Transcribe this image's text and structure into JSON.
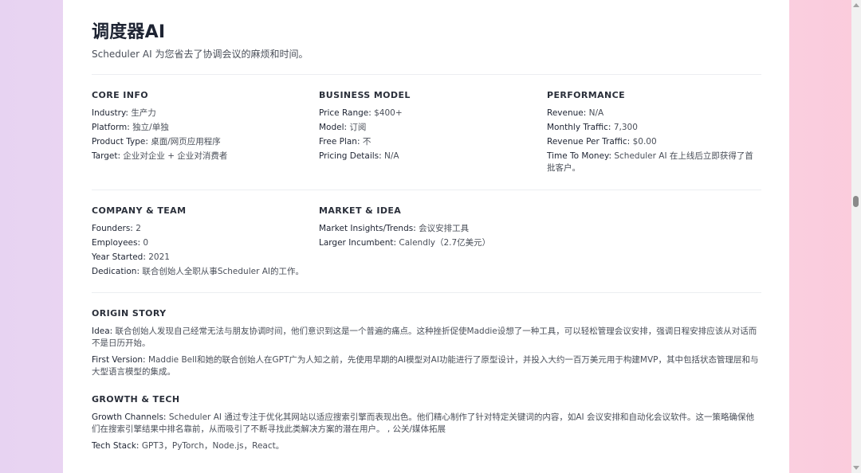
{
  "header": {
    "title": "调度器AI",
    "subtitle": "Scheduler AI 为您省去了协调会议的麻烦和时间。"
  },
  "core_info": {
    "title": "CORE INFO",
    "items": [
      {
        "label": "Industry:",
        "value": "生产力"
      },
      {
        "label": "Platform:",
        "value": "独立/单独"
      },
      {
        "label": "Product Type:",
        "value": "桌面/网页应用程序"
      },
      {
        "label": "Target:",
        "value": "企业对企业 + 企业对消费者"
      }
    ]
  },
  "business_model": {
    "title": "BUSINESS MODEL",
    "items": [
      {
        "label": "Price Range:",
        "value": "$400+"
      },
      {
        "label": "Model:",
        "value": "订阅"
      },
      {
        "label": "Free Plan:",
        "value": "不"
      },
      {
        "label": "Pricing Details:",
        "value": "N/A"
      }
    ]
  },
  "performance": {
    "title": "PERFORMANCE",
    "items": [
      {
        "label": "Revenue:",
        "value": "N/A"
      },
      {
        "label": "Monthly Traffic:",
        "value": "7,300"
      },
      {
        "label": "Revenue Per Traffic:",
        "value": "$0.00"
      },
      {
        "label": "Time To Money:",
        "value": "Scheduler AI 在上线后立即获得了首批客户。"
      }
    ]
  },
  "company_team": {
    "title": "COMPANY & TEAM",
    "items": [
      {
        "label": "Founders:",
        "value": "2"
      },
      {
        "label": "Employees:",
        "value": "0"
      },
      {
        "label": "Year Started:",
        "value": "2021"
      },
      {
        "label": "Dedication:",
        "value": "联合创始人全职从事Scheduler AI的工作。"
      }
    ]
  },
  "market_idea": {
    "title": "MARKET & IDEA",
    "items": [
      {
        "label": "Market Insights/Trends:",
        "value": "会议安排工具"
      },
      {
        "label": "Larger Incumbent:",
        "value": "Calendly（2.7亿美元）"
      }
    ]
  },
  "origin_story": {
    "title": "ORIGIN STORY",
    "items": [
      {
        "label": "Idea:",
        "value": "联合创始人发现自己经常无法与朋友协调时间，他们意识到这是一个普遍的痛点。这种挫折促使Maddie设想了一种工具，可以轻松管理会议安排，强调日程安排应该从对话而不是日历开始。"
      },
      {
        "label": "First Version:",
        "value": "Maddie Bell和她的联合创始人在GPT广为人知之前，先使用早期的AI模型对AI功能进行了原型设计，并投入大约一百万美元用于构建MVP，其中包括状态管理层和与大型语言模型的集成。"
      }
    ]
  },
  "growth_tech": {
    "title": "GROWTH & TECH",
    "items": [
      {
        "label": "Growth Channels:",
        "value": "Scheduler AI 通过专注于优化其网站以适应搜索引擎而表现出色。他们精心制作了针对特定关键词的内容，如AI 会议安排和自动化会议软件。这一策略确保他们在搜索引擎结果中排名靠前，从而吸引了不断寻找此类解决方案的潜在用户。 , 公关/媒体拓展"
      },
      {
        "label": "Tech Stack:",
        "value": "GPT3，PyTorch，Node.js，React。"
      }
    ]
  }
}
